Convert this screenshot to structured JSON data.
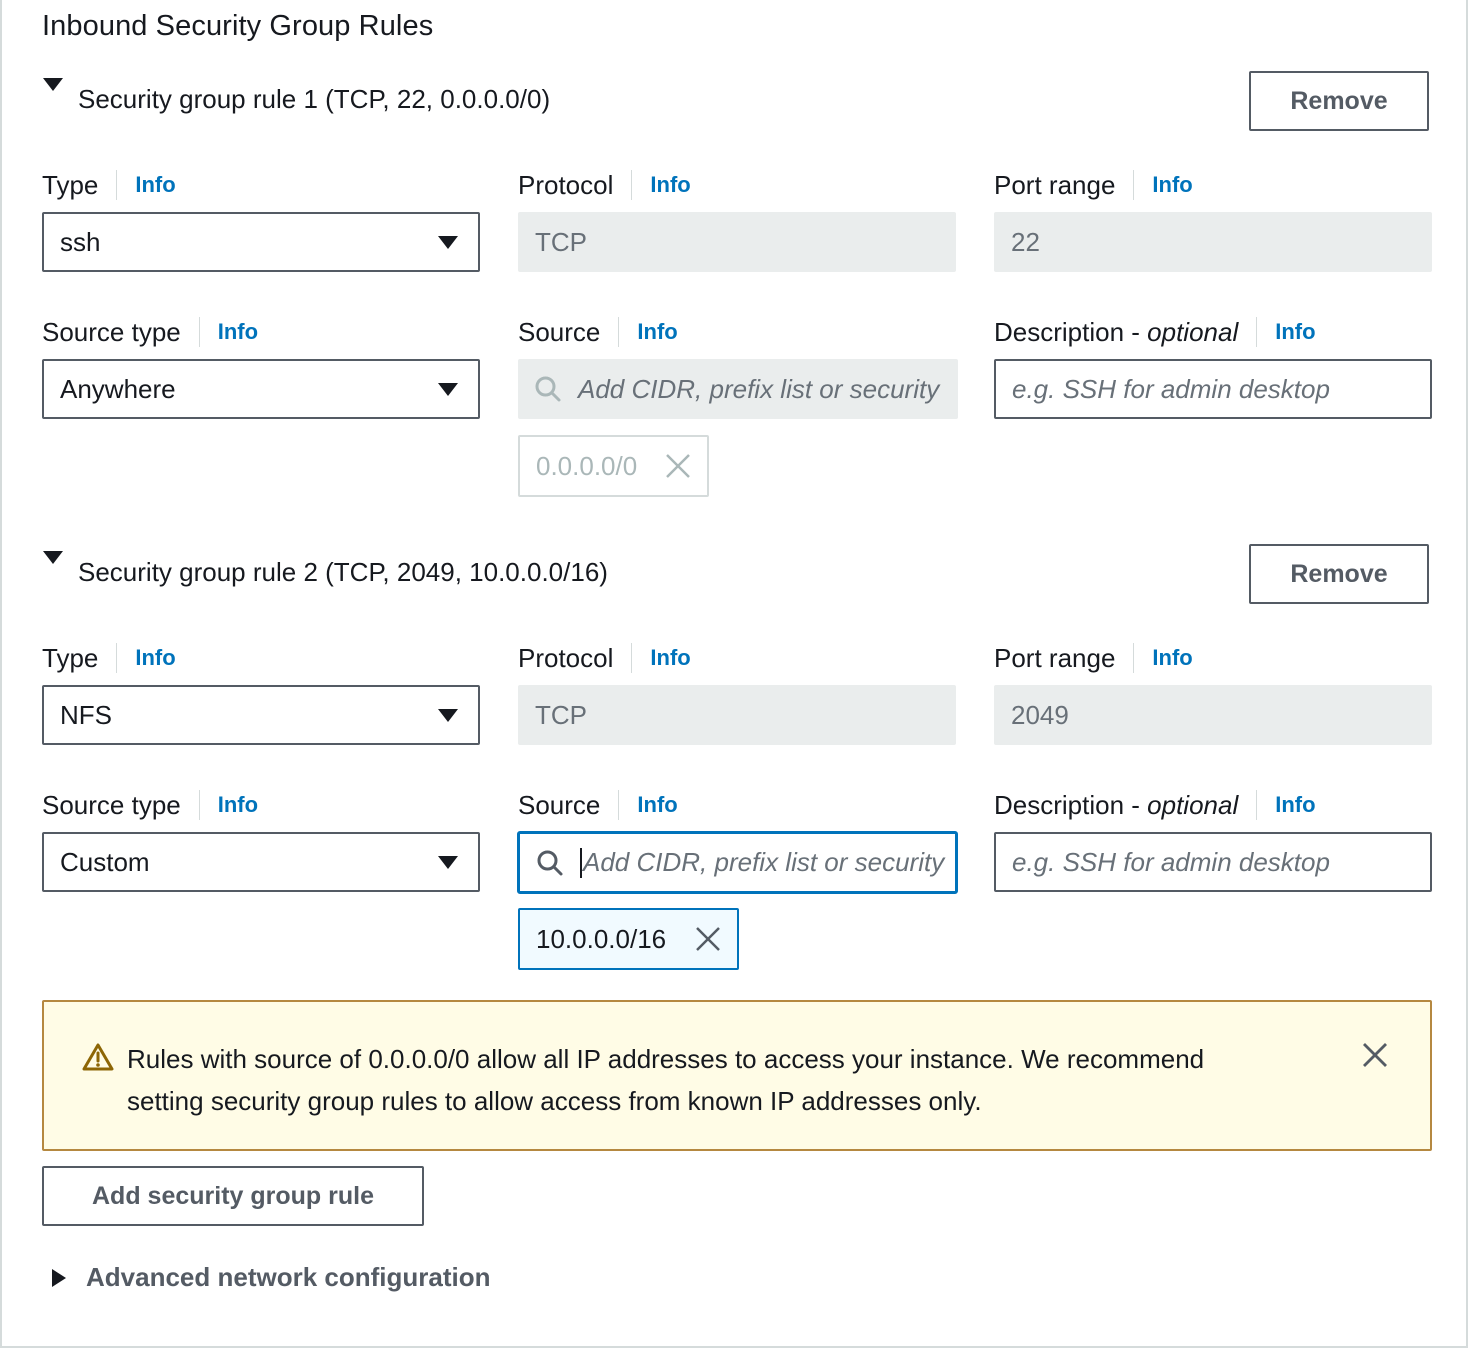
{
  "heading": "Inbound Security Group Rules",
  "info_label": "Info",
  "labels": {
    "type": "Type",
    "protocol": "Protocol",
    "port_range": "Port range",
    "source_type": "Source type",
    "source": "Source",
    "description": "Description - ",
    "description_optional": "optional"
  },
  "remove_label": "Remove",
  "source_placeholder": "Add CIDR, prefix list or security",
  "description_placeholder": "e.g. SSH for admin desktop",
  "rules": [
    {
      "title": "Security group rule 1 (TCP, 22, 0.0.0.0/0)",
      "type": "ssh",
      "protocol": "TCP",
      "port_range": "22",
      "source_type": "Anywhere",
      "source_token": "0.0.0.0/0"
    },
    {
      "title": "Security group rule 2 (TCP, 2049, 10.0.0.0/16)",
      "type": "NFS",
      "protocol": "TCP",
      "port_range": "2049",
      "source_type": "Custom",
      "source_token": "10.0.0.0/16"
    }
  ],
  "alert": {
    "text": "Rules with source of 0.0.0.0/0 allow all IP addresses to access your instance. We recommend setting security group rules to allow access from known IP addresses only.",
    "color": "#b58840"
  },
  "add_rule_label": "Add security group rule",
  "advanced_label": "Advanced network configuration",
  "colors": {
    "link": "#0073bb",
    "focus": "#0073bb",
    "button_border": "#545b64",
    "disabled_bg": "#eaeded"
  }
}
